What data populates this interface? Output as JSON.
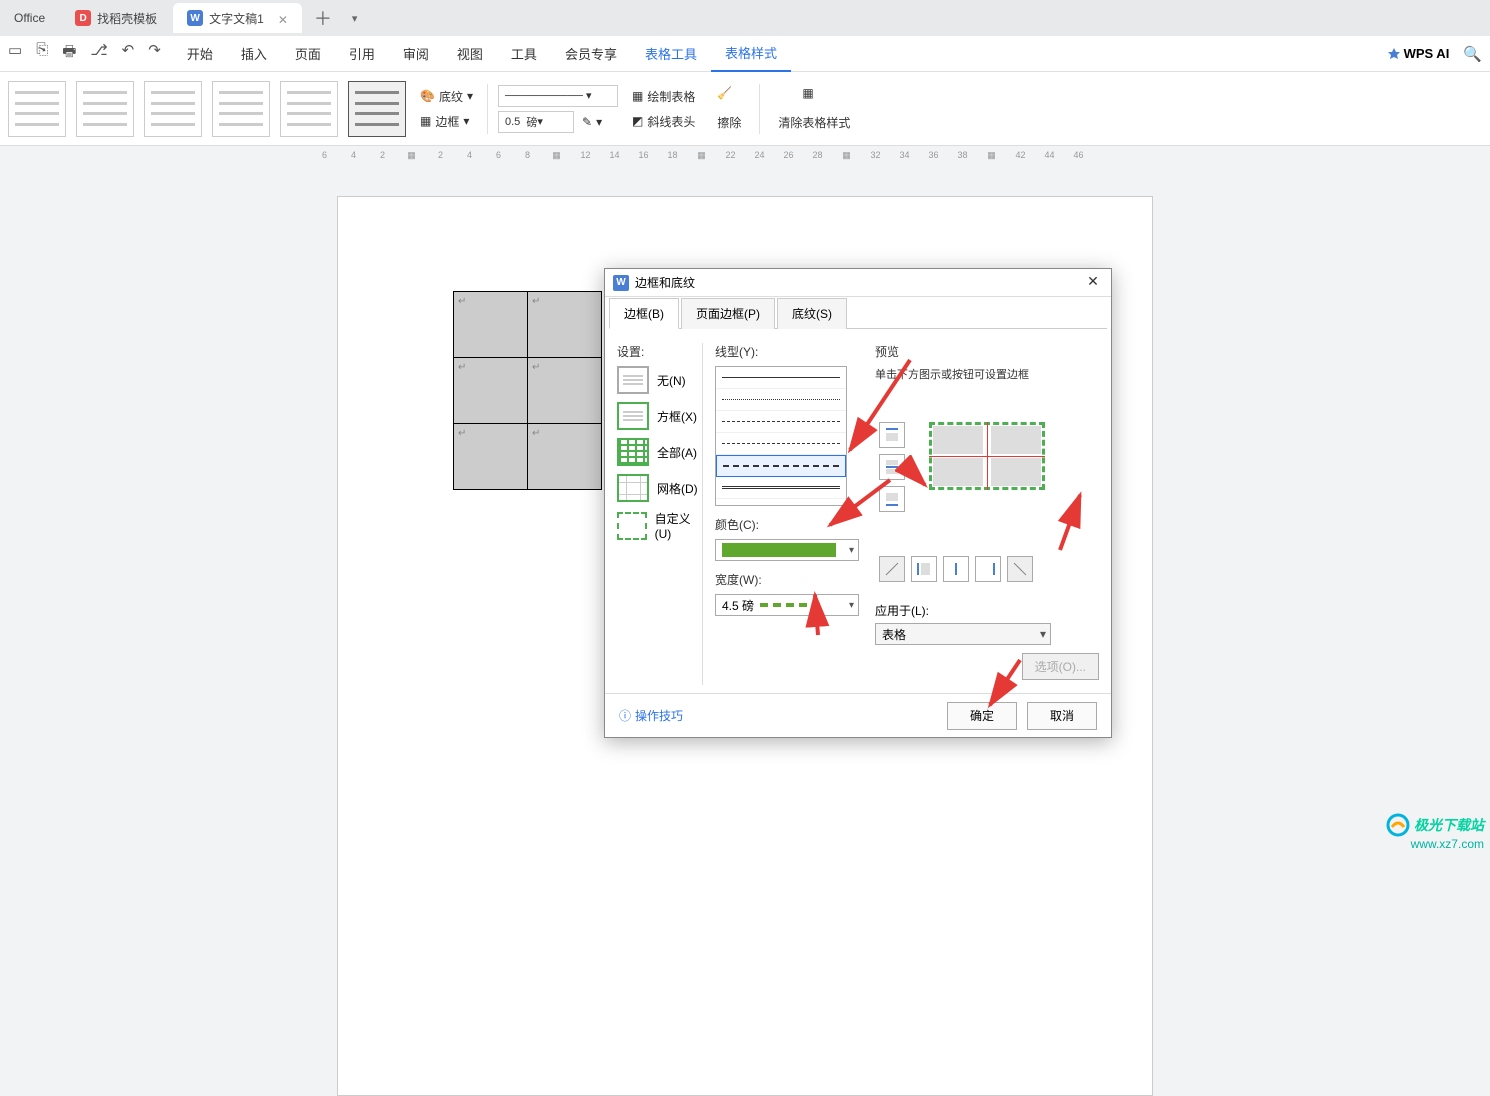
{
  "tabs": {
    "office": "Office",
    "template": "找稻壳模板",
    "doc": "文字文稿1"
  },
  "menu": {
    "start": "开始",
    "insert": "插入",
    "page": "页面",
    "ref": "引用",
    "review": "审阅",
    "view": "视图",
    "tools": "工具",
    "member": "会员专享",
    "tableTools": "表格工具",
    "tableStyle": "表格样式",
    "wpsai": "WPS AI"
  },
  "ribbon": {
    "shading": "底纹",
    "border": "边框",
    "widthVal": "0.5",
    "widthUnit": "磅",
    "drawTable": "绘制表格",
    "diagHeader": "斜线表头",
    "erase": "擦除",
    "clearStyle": "清除表格样式"
  },
  "ruler": [
    "6",
    "4",
    "2",
    "",
    "2",
    "4",
    "6",
    "8",
    "",
    "12",
    "14",
    "16",
    "18",
    "",
    "22",
    "24",
    "26",
    "28",
    "",
    "32",
    "34",
    "36",
    "38",
    "",
    "42",
    "44",
    "46"
  ],
  "dialog": {
    "title": "边框和底纹",
    "tabs": {
      "border": "边框(B)",
      "pageBorder": "页面边框(P)",
      "shading": "底纹(S)"
    },
    "settingLabel": "设置:",
    "settings": {
      "none": "无(N)",
      "box": "方框(X)",
      "all": "全部(A)",
      "grid": "网格(D)",
      "custom": "自定义(U)"
    },
    "lineLabel": "线型(Y):",
    "colorLabel": "颜色(C):",
    "widthLabel": "宽度(W):",
    "widthVal": "4.5  磅",
    "previewLabel": "预览",
    "previewHint": "单击下方图示或按钮可设置边框",
    "applyLabel": "应用于(L):",
    "applyVal": "表格",
    "optionsBtn": "选项(O)...",
    "tips": "操作技巧",
    "ok": "确定",
    "cancel": "取消"
  },
  "watermark": {
    "brand": "极光下载站",
    "url": "www.xz7.com"
  }
}
